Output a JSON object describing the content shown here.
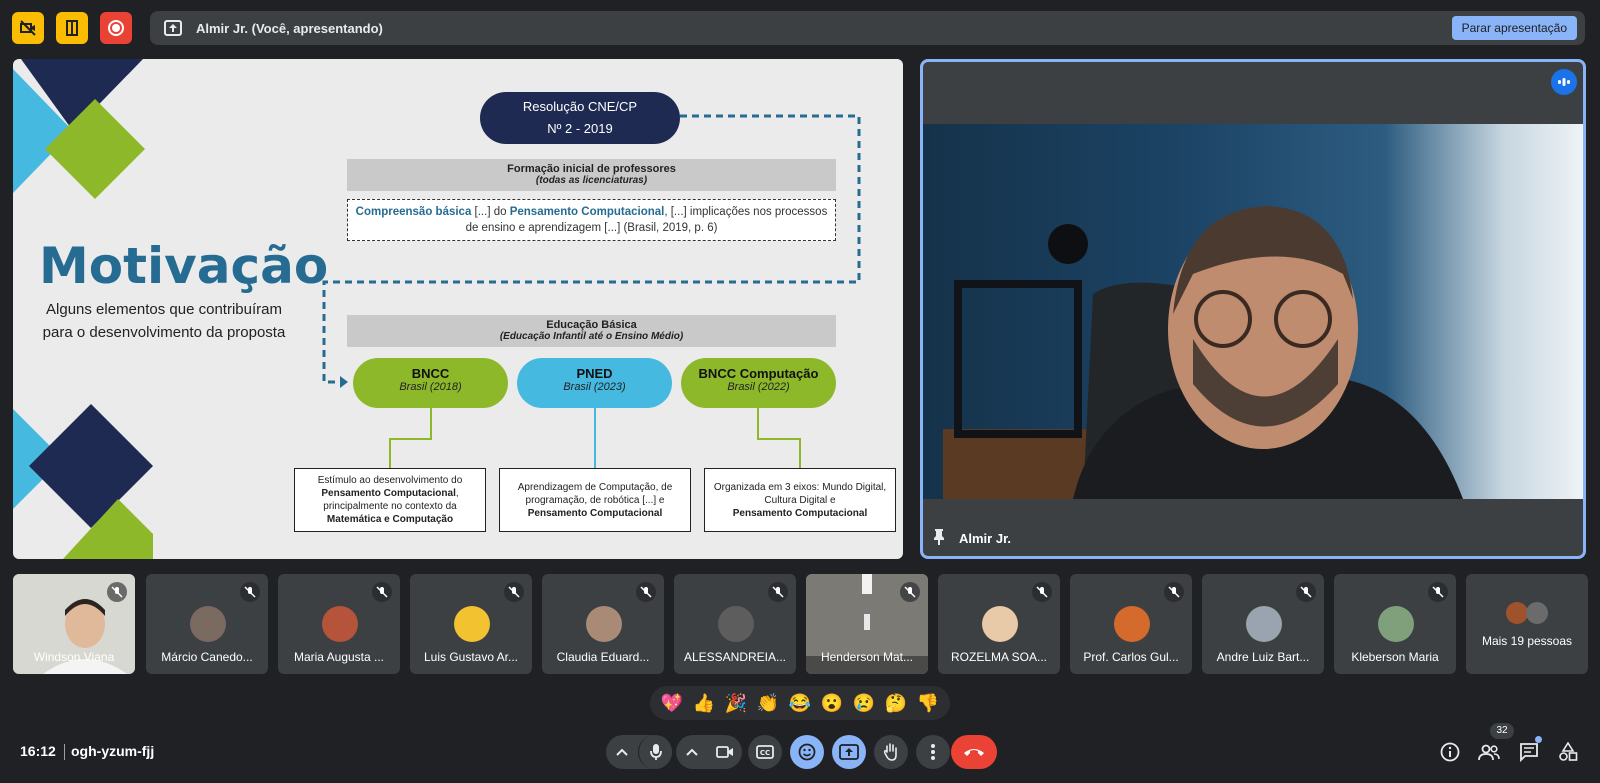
{
  "topbar": {
    "presenting_label": "Almir Jr. (Você, apresentando)",
    "stop_label": "Parar apresentação"
  },
  "slide": {
    "title": "Motivação",
    "subtitle": "Alguns elementos que contribuíram para o desenvolvimento da proposta",
    "resolution_line1": "Resolução CNE/CP",
    "resolution_line2": "Nº 2 - 2019",
    "formacao_title": "Formação inicial de professores",
    "formacao_sub": "(todas as licenciaturas)",
    "quote_part1": "Compreensão básica",
    "quote_part2": " [...] do ",
    "quote_part3": "Pensamento Computacional",
    "quote_part4": ", [...] implicações nos processos de ensino e aprendizagem [...] (Brasil, 2019, p. 6)",
    "educacao_title": "Educação Básica",
    "educacao_sub": "(Educação Infantil até o Ensino Médio)",
    "pills": [
      {
        "title": "BNCC",
        "sub": "Brasil (2018)"
      },
      {
        "title": "PNED",
        "sub": "Brasil (2023)"
      },
      {
        "title": "BNCC Computação",
        "sub": "Brasil (2022)"
      }
    ],
    "box1_a": "Estímulo ao desenvolvimento do",
    "box1_b": "Pensamento Computacional",
    "box1_c": ", principalmente no contexto da",
    "box1_d": "Matemática e Computação",
    "box2_a": "Aprendizagem de Computação, de programação, de robótica [...] e",
    "box2_b": "Pensamento Computacional",
    "box3_a": "Organizada em 3 eixos: Mundo Digital, Cultura Digital e",
    "box3_b": "Pensamento Computacional"
  },
  "speaker": {
    "name": "Almir Jr."
  },
  "participants": [
    {
      "name": "Windson Viana"
    },
    {
      "name": "Márcio Canedo..."
    },
    {
      "name": "Maria Augusta ..."
    },
    {
      "name": "Luis Gustavo Ar..."
    },
    {
      "name": "Claudia Eduard..."
    },
    {
      "name": "ALESSANDREIA..."
    },
    {
      "name": "Henderson Mat..."
    },
    {
      "name": "ROZELMA SOA..."
    },
    {
      "name": "Prof. Carlos Gul..."
    },
    {
      "name": "Andre Luiz Bart..."
    },
    {
      "name": "Kleberson Maria"
    },
    {
      "name": "Mais 19 pessoas"
    }
  ],
  "reactions": [
    "💖",
    "👍",
    "🎉",
    "👏",
    "😂",
    "😮",
    "😢",
    "🤔",
    "👎"
  ],
  "bottombar": {
    "time": "16:12",
    "meeting_code": "ogh-yzum-fjj",
    "participants_count": "32"
  }
}
